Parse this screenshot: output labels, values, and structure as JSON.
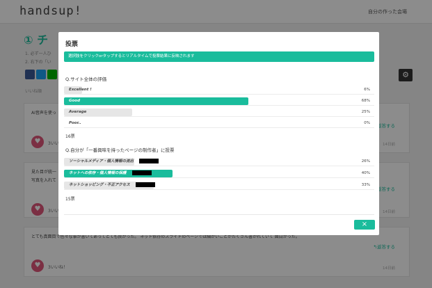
{
  "app": {
    "brand": "handsup!",
    "my_page": "自分の作った会場"
  },
  "background": {
    "page_title": "① チ",
    "desc_lines": [
      "1. 必ず一人ひ",
      "2. 右下の「い"
    ],
    "likes_header": "いいね順",
    "cards": [
      {
        "text": "AI音声を使っ",
        "reply": "↰返答する",
        "likes": "3いいね",
        "ago": "14日前"
      },
      {
        "text": "見た目が統一",
        "text2": "写真を入れて",
        "reply": "↰返答する",
        "likes": "3いい",
        "ago": "14日前"
      },
      {
        "text": "とても真面目で色々な事が書いてあってとても良かった。 ネット依存のスライドのページでは細かいことがたくさん書かれていて 面白かった。",
        "reply": "↰返答する",
        "likes": "3いいね！",
        "ago": "14日前"
      }
    ]
  },
  "modal": {
    "title": "投票",
    "notice": "選択肢をクリックorタップするとリアルタイムで投票結果に反映されます",
    "close_label": "×",
    "questions": [
      {
        "title": "Q.サイト全体の評価",
        "votes": "16票",
        "options": [
          {
            "label": "Excellent !",
            "percent": 6,
            "pct_label": "6%",
            "selected": false
          },
          {
            "label": "Good",
            "percent": 68,
            "pct_label": "68%",
            "selected": true
          },
          {
            "label": "Average",
            "percent": 25,
            "pct_label": "25%",
            "selected": false
          },
          {
            "label": "Poor..",
            "percent": 0,
            "pct_label": "0%",
            "selected": false
          }
        ]
      },
      {
        "title": "Q.自分が「一番興味を持ったページの制作者」に投票",
        "votes": "15票",
        "options": [
          {
            "label": "ソーシャルメディア・個人情報の流出",
            "percent": 26,
            "pct_label": "26%",
            "selected": false
          },
          {
            "label": "ネットへの依存・個人情報の保護",
            "percent": 40,
            "pct_label": "40%",
            "selected": true
          },
          {
            "label": "ネットショッピング・不正アクセス",
            "percent": 33,
            "pct_label": "33%",
            "selected": false
          }
        ]
      }
    ]
  },
  "colors": {
    "accent": "#1abc9c",
    "unselected_bar": "#e6e6e6",
    "overlay": "rgba(0,0,0,0.45)"
  }
}
